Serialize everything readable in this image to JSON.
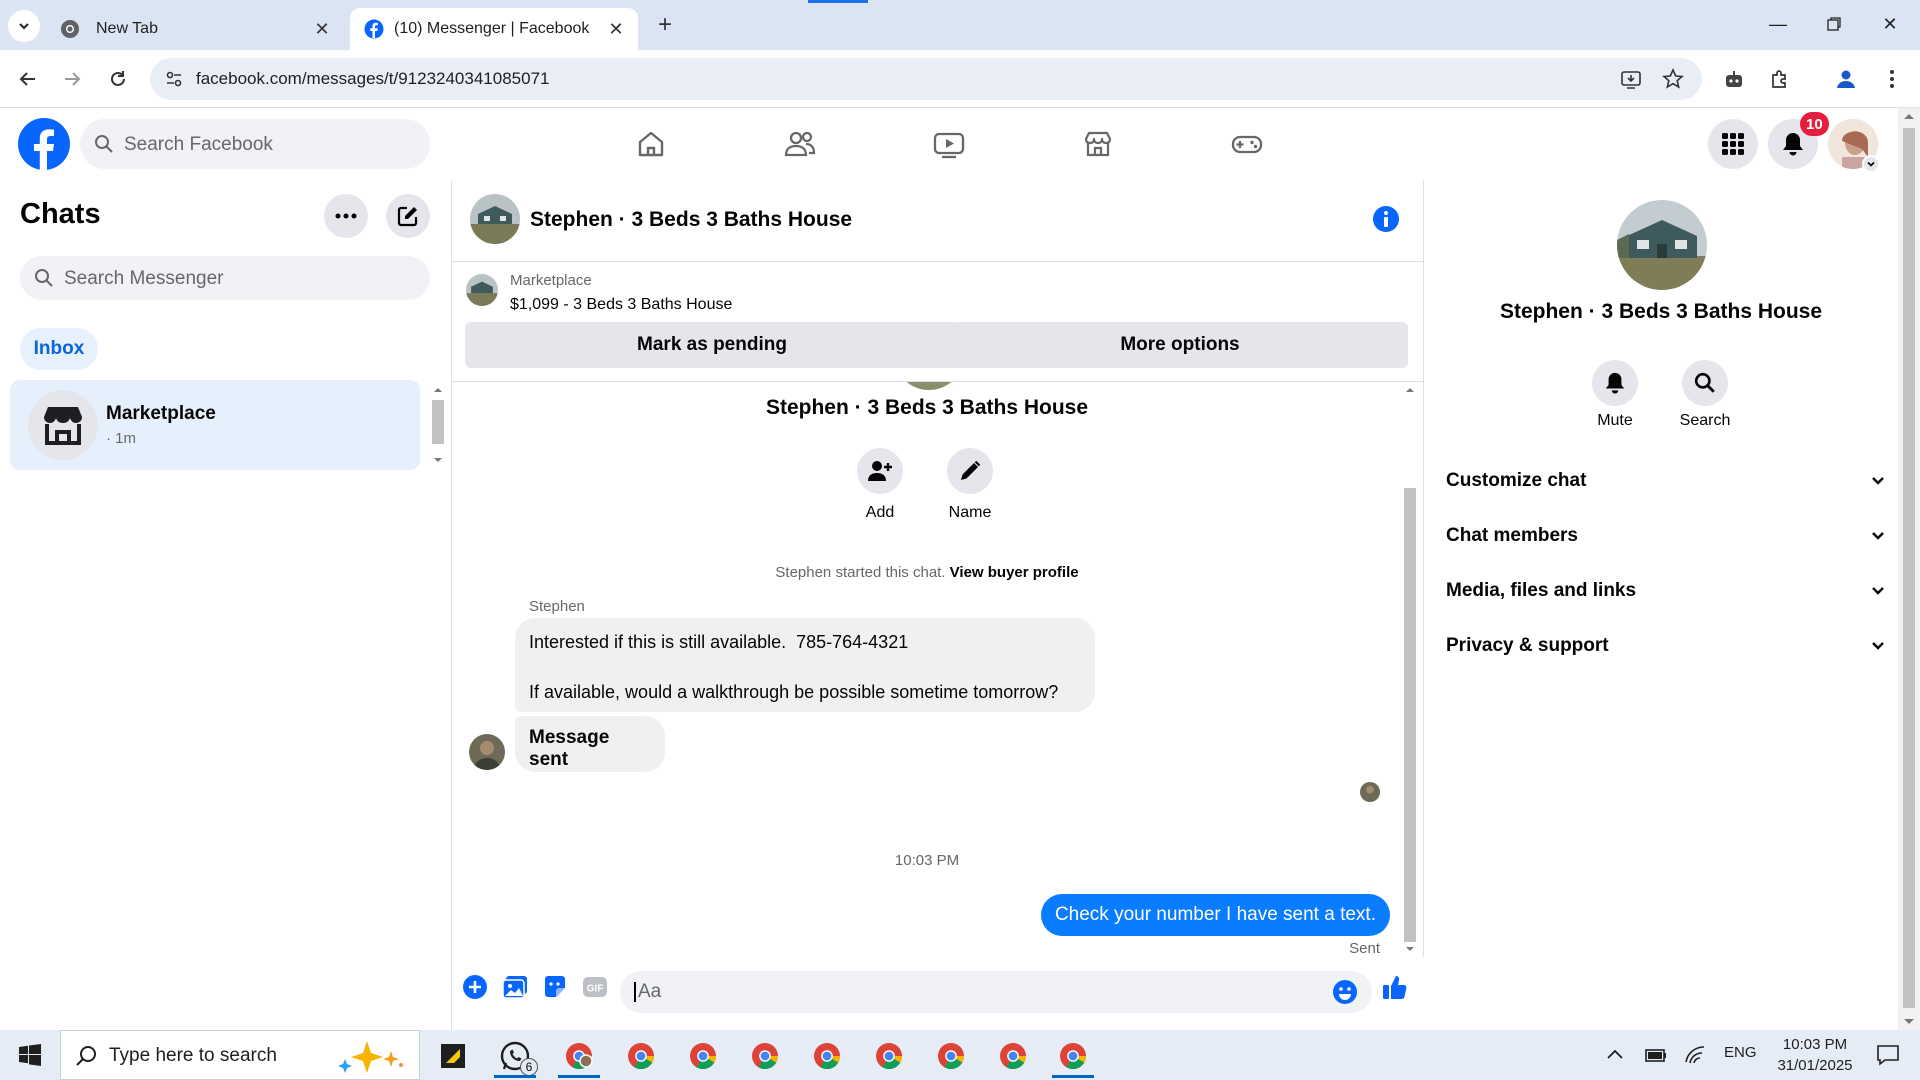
{
  "browser": {
    "tabs": [
      {
        "title": "New Tab",
        "active": false
      },
      {
        "title": "(10) Messenger | Facebook",
        "active": true
      }
    ],
    "url": "facebook.com/messages/t/9123240341085071"
  },
  "fb_header": {
    "search_placeholder": "Search Facebook",
    "notification_count": "10",
    "brand_color": "#0866ff"
  },
  "sidebar": {
    "title": "Chats",
    "search_placeholder": "Search Messenger",
    "filter": "Inbox",
    "chats": [
      {
        "name": "Marketplace",
        "time": "· 1m"
      }
    ]
  },
  "conversation": {
    "title": "Stephen · 3 Beds 3 Baths House",
    "marketplace": {
      "label": "Marketplace",
      "listing": "$1,099 - 3 Beds 3 Baths House",
      "mark_pending": "Mark as pending",
      "more_options": "More options"
    },
    "thread_title": "Stephen · 3 Beds 3 Baths House",
    "actions": [
      {
        "label": "Add",
        "icon": "add-person-icon"
      },
      {
        "label": "Name",
        "icon": "pencil-icon"
      }
    ],
    "started_text": "Stephen started this chat.",
    "buyer_profile_link": "View buyer profile",
    "sender": "Stephen",
    "incoming": {
      "line1": "Interested if this is still available.  785-764-4321",
      "line2": "If available, would a walkthrough be possible sometime tomorrow?"
    },
    "message_sent": "Message sent",
    "time_separator": "10:03 PM",
    "outgoing": "Check your number I have sent a text.",
    "sent_status": "Sent",
    "composer_placeholder": "Aa",
    "outgoing_color": "#0a7cff"
  },
  "right_panel": {
    "title": "Stephen · 3 Beds 3 Baths House",
    "actions": [
      {
        "label": "Mute",
        "icon": "bell-icon"
      },
      {
        "label": "Search",
        "icon": "search-icon"
      }
    ],
    "sections": [
      "Customize chat",
      "Chat members",
      "Media, files and links",
      "Privacy & support"
    ]
  },
  "taskbar": {
    "search_placeholder": "Type here to search",
    "whatsapp_badge": "6",
    "language": "ENG",
    "time": "10:03 PM",
    "date": "31/01/2025"
  }
}
